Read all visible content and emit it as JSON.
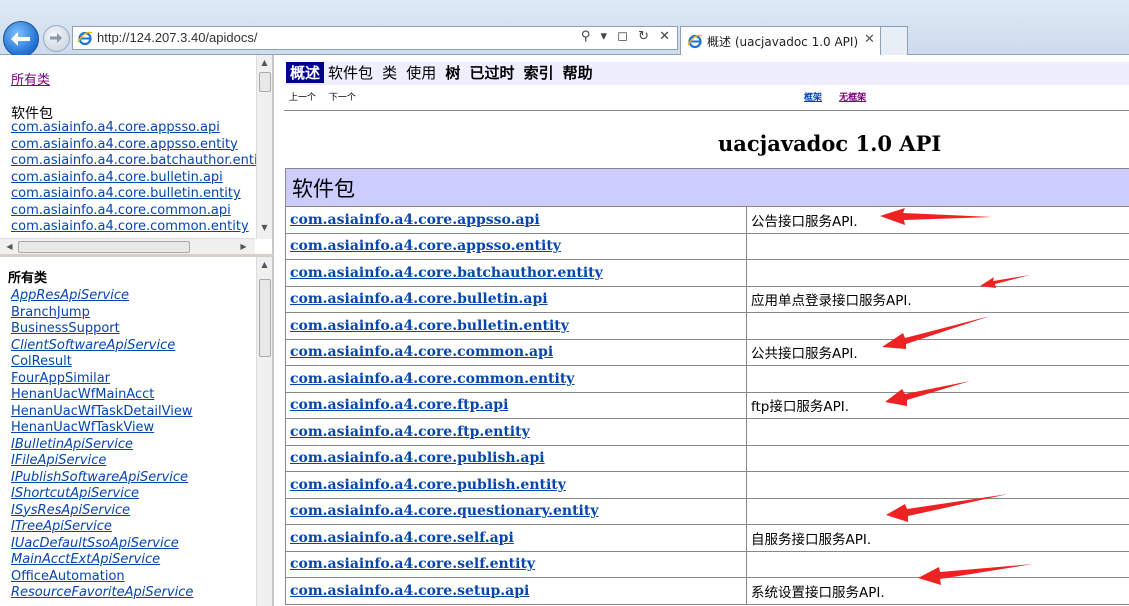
{
  "browser": {
    "url": "http://124.207.3.40/apidocs/",
    "address_tools": "⚲ ▾ ◻ ↻ ✕",
    "tab_title": "概述 (uacjavadoc 1.0 API)",
    "tab_close": "✕"
  },
  "package_frame": {
    "all_classes_link": "所有类",
    "heading": "软件包",
    "packages": [
      "com.asiainfo.a4.core.appsso.api",
      "com.asiainfo.a4.core.appsso.entity",
      "com.asiainfo.a4.core.batchauthor.entity",
      "com.asiainfo.a4.core.bulletin.api",
      "com.asiainfo.a4.core.bulletin.entity",
      "com.asiainfo.a4.core.common.api",
      "com.asiainfo.a4.core.common.entity"
    ]
  },
  "classes_frame": {
    "heading": "所有类",
    "classes": [
      {
        "name": "AppResApiService",
        "italic": true
      },
      {
        "name": "BranchJump",
        "italic": false
      },
      {
        "name": "BusinessSupport",
        "italic": false
      },
      {
        "name": "ClientSoftwareApiService",
        "italic": true
      },
      {
        "name": "ColResult",
        "italic": false
      },
      {
        "name": "FourAppSimilar",
        "italic": false
      },
      {
        "name": "HenanUacWfMainAcct",
        "italic": false
      },
      {
        "name": "HenanUacWfTaskDetailView",
        "italic": false
      },
      {
        "name": "HenanUacWfTaskView",
        "italic": false
      },
      {
        "name": "IBulletinApiService",
        "italic": true
      },
      {
        "name": "IFileApiService",
        "italic": true
      },
      {
        "name": "IPublishSoftwareApiService",
        "italic": true
      },
      {
        "name": "IShortcutApiService",
        "italic": true
      },
      {
        "name": "ISysResApiService",
        "italic": true
      },
      {
        "name": "ITreeApiService",
        "italic": true
      },
      {
        "name": "IUacDefaultSsoApiService",
        "italic": true
      },
      {
        "name": "MainAcctExtApiService",
        "italic": true
      },
      {
        "name": "OfficeAutomation",
        "italic": false
      },
      {
        "name": "ResourceFavoriteApiService",
        "italic": true
      }
    ]
  },
  "main_frame": {
    "navbar": {
      "overview": "概述",
      "package": "软件包",
      "class": "类",
      "use": "使用",
      "tree": "树",
      "deprecated": "已过时",
      "index": "索引",
      "help": "帮助"
    },
    "subnav": {
      "prev": "上一个",
      "next": "下一个",
      "frames": "框架",
      "no_frames": "无框架"
    },
    "title": "uacjavadoc 1.0 API",
    "table_heading": "软件包",
    "rows": [
      {
        "package": "com.asiainfo.a4.core.appsso.api",
        "description": "公告接口服务API."
      },
      {
        "package": "com.asiainfo.a4.core.appsso.entity",
        "description": ""
      },
      {
        "package": "com.asiainfo.a4.core.batchauthor.entity",
        "description": ""
      },
      {
        "package": "com.asiainfo.a4.core.bulletin.api",
        "description": "应用单点登录接口服务API."
      },
      {
        "package": "com.asiainfo.a4.core.bulletin.entity",
        "description": ""
      },
      {
        "package": "com.asiainfo.a4.core.common.api",
        "description": "公共接口服务API."
      },
      {
        "package": "com.asiainfo.a4.core.common.entity",
        "description": ""
      },
      {
        "package": "com.asiainfo.a4.core.ftp.api",
        "description": "ftp接口服务API."
      },
      {
        "package": "com.asiainfo.a4.core.ftp.entity",
        "description": ""
      },
      {
        "package": "com.asiainfo.a4.core.publish.api",
        "description": ""
      },
      {
        "package": "com.asiainfo.a4.core.publish.entity",
        "description": ""
      },
      {
        "package": "com.asiainfo.a4.core.questionary.entity",
        "description": ""
      },
      {
        "package": "com.asiainfo.a4.core.self.api",
        "description": "自服务接口服务API."
      },
      {
        "package": "com.asiainfo.a4.core.self.entity",
        "description": ""
      },
      {
        "package": "com.asiainfo.a4.core.setup.api",
        "description": "系统设置接口服务API."
      }
    ]
  },
  "colors": {
    "navbar_bg": "#eeeeff",
    "table_header_bg": "#ccccff",
    "active_tab_bg": "#00008b",
    "link": "#0645ad",
    "visited_link": "#800080",
    "annotation_arrow": "#ee2222"
  },
  "icons": {
    "back": "back-arrow-icon",
    "forward": "forward-arrow-icon",
    "browser": "ie-logo-icon"
  }
}
